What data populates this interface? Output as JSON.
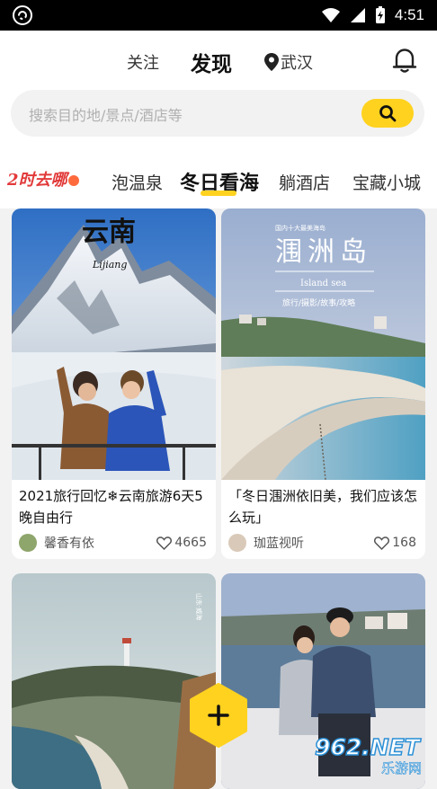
{
  "status_bar": {
    "time": "4:51"
  },
  "top_nav": {
    "follow": "关注",
    "discover": "发现",
    "city": "武汉"
  },
  "search": {
    "placeholder": "搜索目的地/景点/酒店等"
  },
  "categories": {
    "logo_text": "2时去哪",
    "items": [
      "泡温泉",
      "冬日看海",
      "躺酒店",
      "宝藏小城"
    ],
    "active_index": 1
  },
  "cards": [
    {
      "title": "2021旅行回忆❄云南旅游6天5晚自由行",
      "author": "馨香有依",
      "likes": "4665",
      "image_text": {
        "main": "云南",
        "sub": "Lijiang"
      }
    },
    {
      "title": "「冬日涠洲依旧美，我们应该怎么玩」",
      "author": "珈蓝视听",
      "likes": "168",
      "image_text": {
        "small": "国内十大最美海岛",
        "main": "涠洲岛",
        "en": "Island sea",
        "tags": "旅行/摄影/故事/攻略"
      }
    },
    {
      "title": "",
      "author": "",
      "likes": "",
      "image_text": {
        "side": "山东·威海"
      }
    },
    {
      "title": "",
      "author": "",
      "likes": ""
    }
  ],
  "watermark": {
    "text": "962.NET",
    "sub": "乐游网"
  },
  "colors": {
    "accent": "#ffd21f",
    "logo_red": "#e23a3a"
  }
}
